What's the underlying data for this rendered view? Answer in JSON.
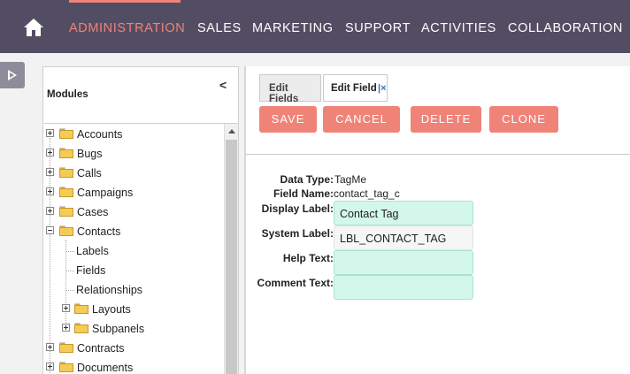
{
  "nav": {
    "items": [
      {
        "label": "ADMINISTRATION",
        "active": true
      },
      {
        "label": "SALES"
      },
      {
        "label": "MARKETING"
      },
      {
        "label": "SUPPORT"
      },
      {
        "label": "ACTIVITIES"
      },
      {
        "label": "COLLABORATION"
      }
    ],
    "accent_color": "#f08377",
    "bg_color": "#534d64"
  },
  "modules": {
    "title": "Modules",
    "tree": [
      {
        "label": "Accounts"
      },
      {
        "label": "Bugs"
      },
      {
        "label": "Calls"
      },
      {
        "label": "Campaigns"
      },
      {
        "label": "Cases"
      },
      {
        "label": "Contacts"
      },
      {
        "label": "Labels"
      },
      {
        "label": "Fields"
      },
      {
        "label": "Relationships"
      },
      {
        "label": "Layouts"
      },
      {
        "label": "Subpanels"
      },
      {
        "label": "Contracts"
      },
      {
        "label": "Documents"
      }
    ]
  },
  "tabs": [
    {
      "label": "Edit Fields"
    },
    {
      "label": "Edit Field"
    }
  ],
  "buttons": {
    "save": "SAVE",
    "cancel": "CANCEL",
    "delete": "DELETE",
    "clone": "CLONE"
  },
  "form": {
    "data_type_label": "Data Type:",
    "data_type_value": "TagMe",
    "field_name_label": "Field Name:",
    "field_name_value": "contact_tag_c",
    "display_label_label": "Display Label:",
    "display_label_value": "Contact Tag",
    "system_label_label": "System Label:",
    "system_label_value": "LBL_CONTACT_TAG",
    "help_text_label": "Help Text:",
    "help_text_value": "",
    "comment_text_label": "Comment Text:",
    "comment_text_value": ""
  }
}
